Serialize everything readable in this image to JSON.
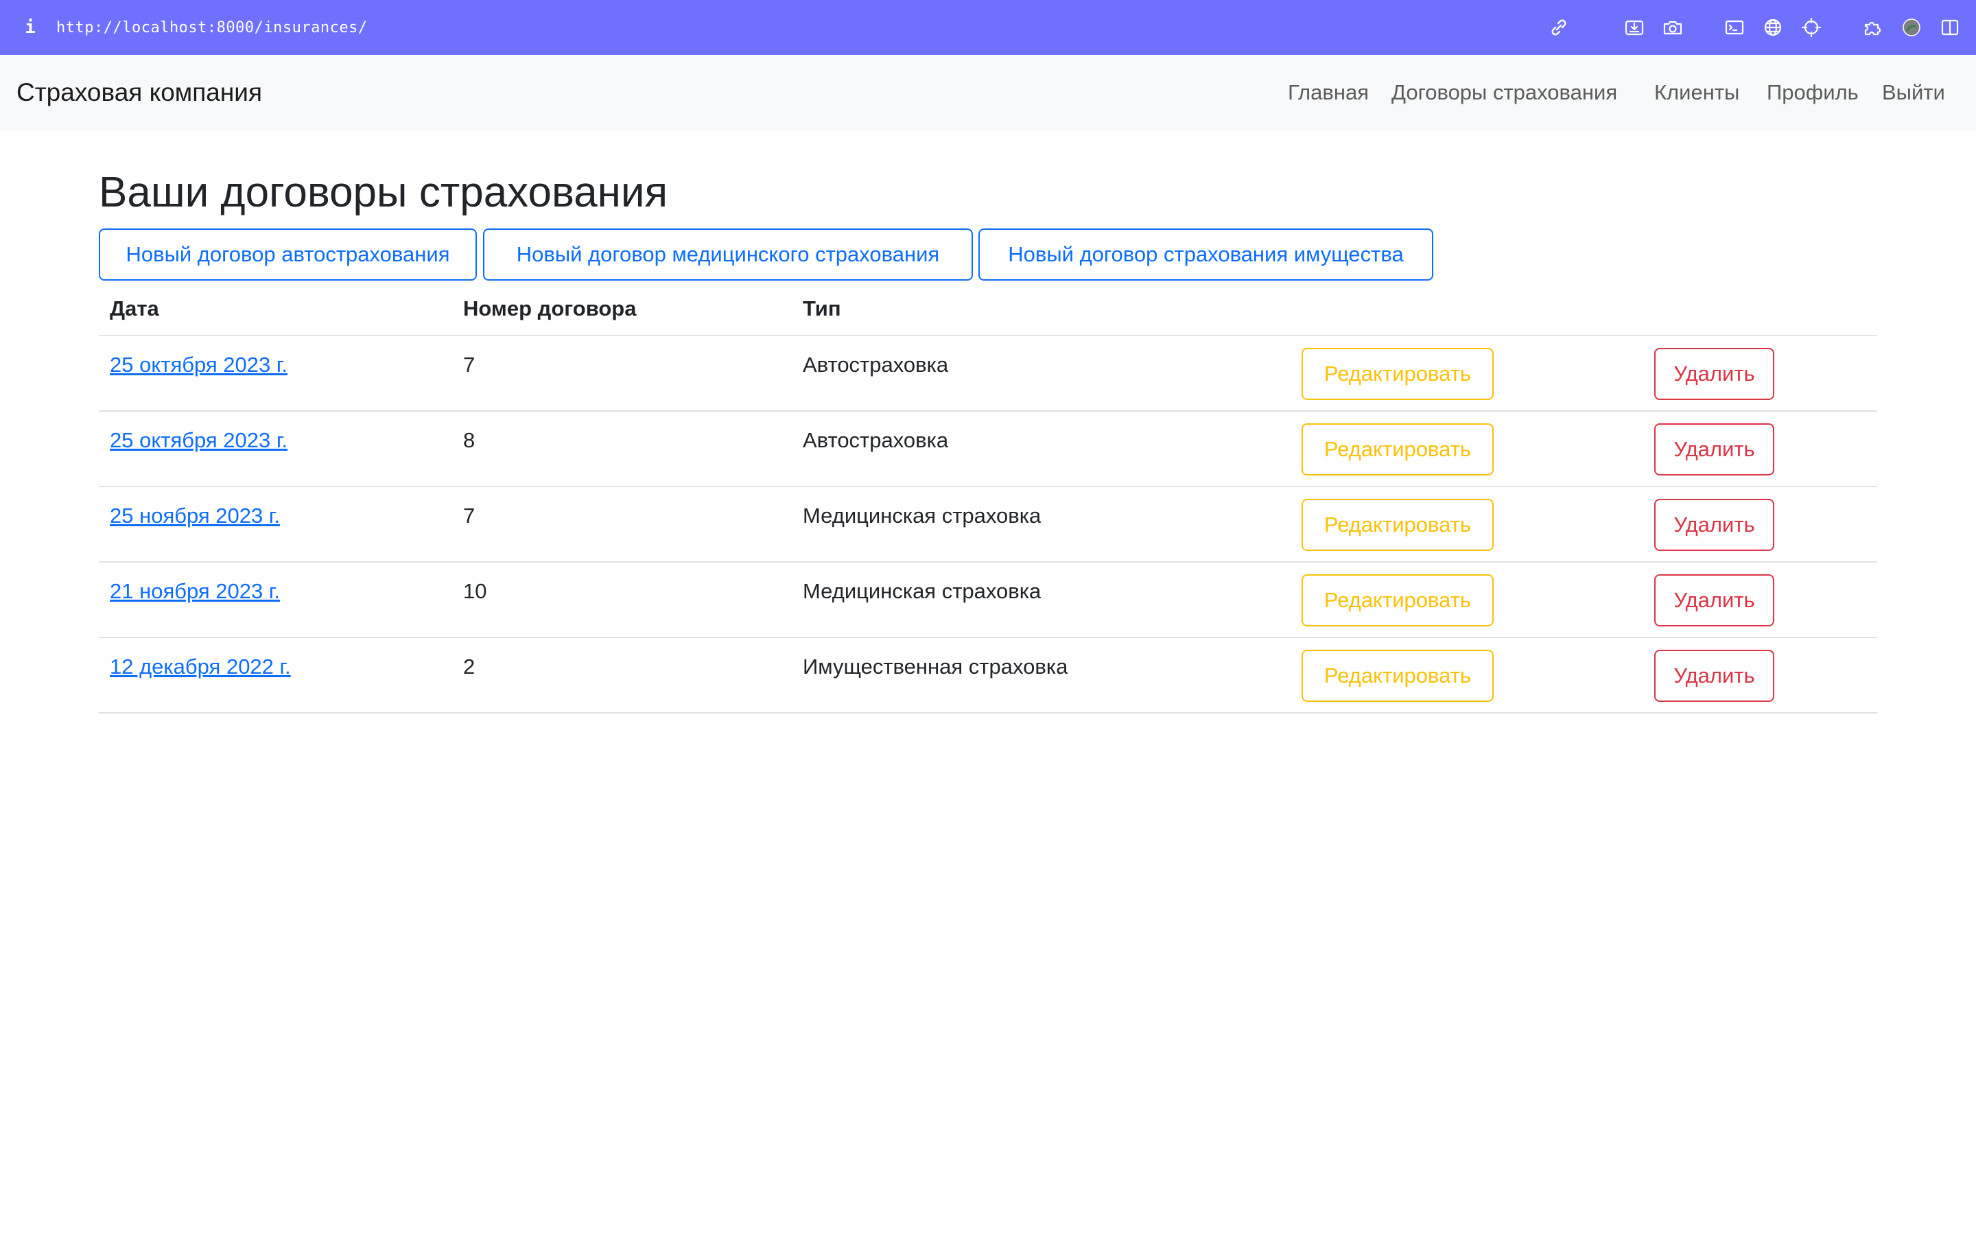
{
  "browser": {
    "url": "http://localhost:8000/insurances/",
    "info_glyph": "i",
    "icons": [
      "link-icon",
      "download-icon",
      "camera-icon",
      "terminal-icon",
      "globe-icon",
      "crosshair-icon",
      "puzzle-icon",
      "avatar-icon",
      "sidebar-icon"
    ],
    "bar_color": "#7070ff"
  },
  "navbar": {
    "brand": "Страховая компания",
    "links": [
      "Главная",
      "Договоры страхования",
      "Клиенты",
      "Профиль",
      "Выйти"
    ]
  },
  "main": {
    "title": "Ваши договоры страхования",
    "actions": [
      "Новый договор автострахования",
      "Новый договор медицинского страхования",
      "Новый договор страхования имущества"
    ],
    "table": {
      "headers": [
        "Дата",
        "Номер договора",
        "Тип"
      ],
      "rows": [
        {
          "date": "25 октября 2023 г.",
          "number": "7",
          "type": "Автостраховка",
          "edit": "Редактировать",
          "delete": "Удалить"
        },
        {
          "date": "25 октября 2023 г.",
          "number": "8",
          "type": "Автостраховка",
          "edit": "Редактировать",
          "delete": "Удалить"
        },
        {
          "date": "25 ноября 2023 г.",
          "number": "7",
          "type": "Медицинская страховка",
          "edit": "Редактировать",
          "delete": "Удалить"
        },
        {
          "date": "21 ноября 2023 г.",
          "number": "10",
          "type": "Медицинская страховка",
          "edit": "Редактировать",
          "delete": "Удалить"
        },
        {
          "date": "12 декабря 2022 г.",
          "number": "2",
          "type": "Имущественная страховка",
          "edit": "Редактировать",
          "delete": "Удалить"
        }
      ]
    }
  },
  "colors": {
    "primary": "#0d6efd",
    "warning": "#ffc107",
    "danger": "#dc3545",
    "navbar_bg": "#f8f9fa"
  }
}
